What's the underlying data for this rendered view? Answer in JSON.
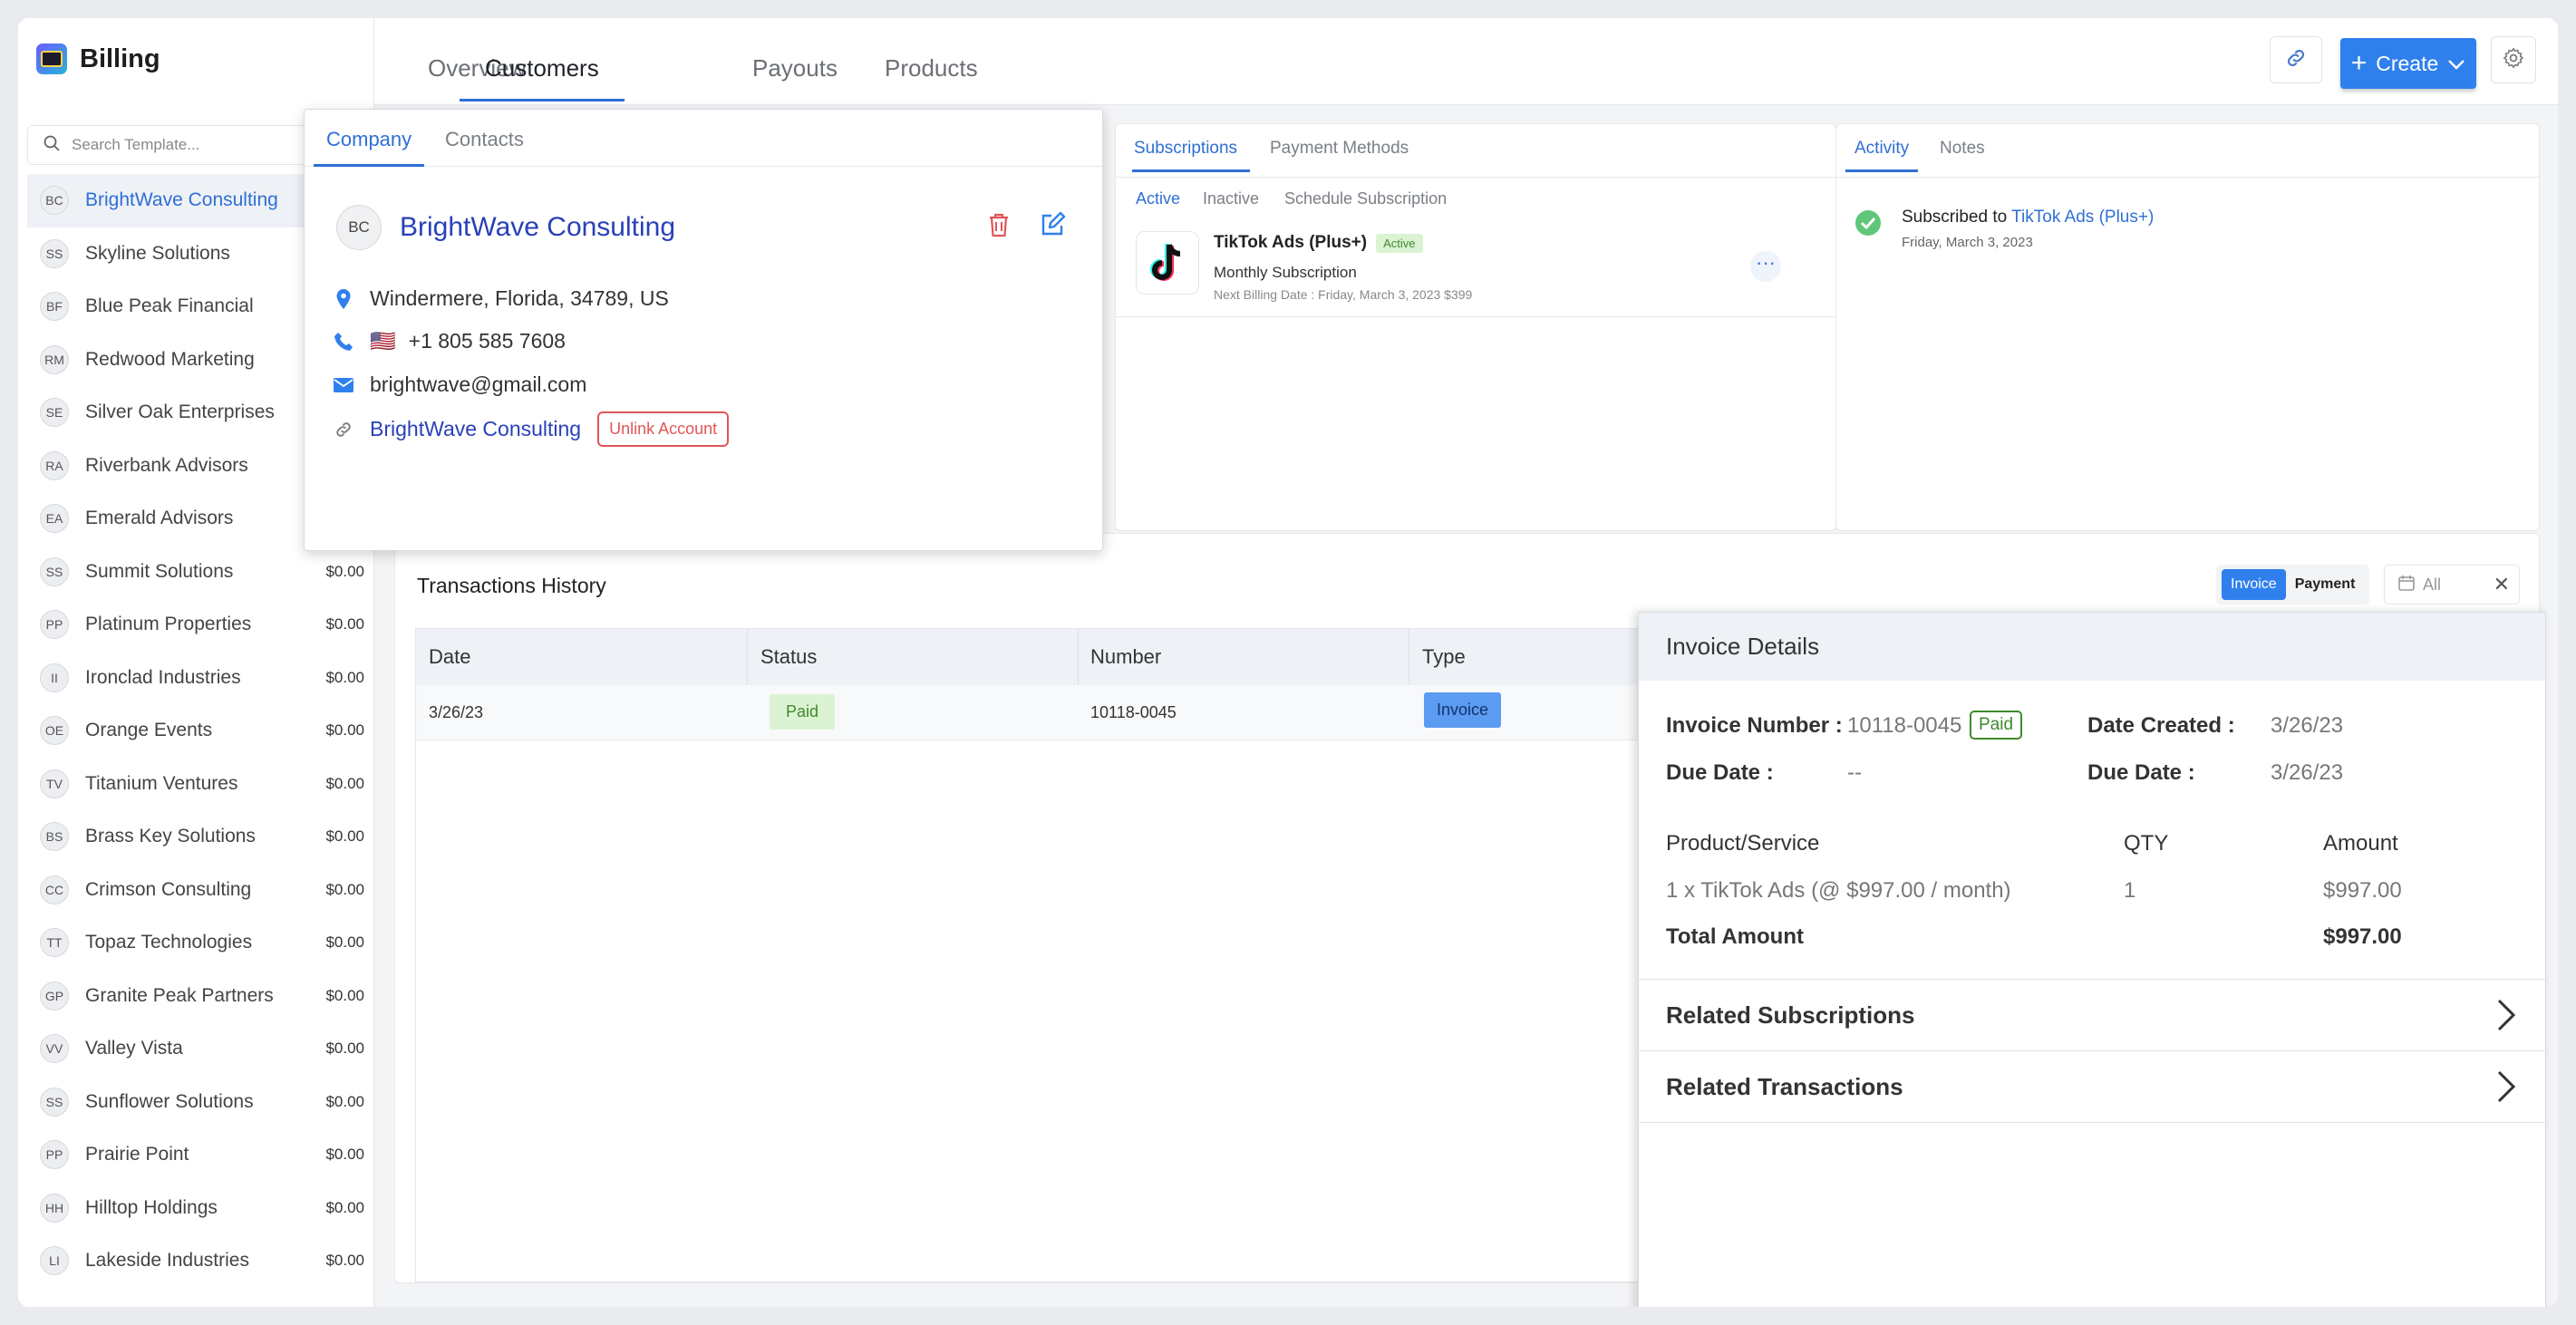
{
  "app": {
    "title": "Billing"
  },
  "nav": {
    "tabs": [
      "Overview",
      "Customers",
      "Payouts",
      "Products"
    ],
    "active": "Customers",
    "create_label": "Create"
  },
  "search": {
    "placeholder": "Search Template..."
  },
  "customers": [
    {
      "initials": "BC",
      "name": "BrightWave Consulting",
      "amount": ""
    },
    {
      "initials": "SS",
      "name": "Skyline Solutions",
      "amount": ""
    },
    {
      "initials": "BF",
      "name": "Blue Peak Financial",
      "amount": ""
    },
    {
      "initials": "RM",
      "name": "Redwood Marketing",
      "amount": ""
    },
    {
      "initials": "SE",
      "name": "Silver Oak Enterprises",
      "amount": ""
    },
    {
      "initials": "RA",
      "name": "Riverbank Advisors",
      "amount": ""
    },
    {
      "initials": "EA",
      "name": "Emerald Advisors",
      "amount": ""
    },
    {
      "initials": "SS",
      "name": "Summit Solutions",
      "amount": "$0.00"
    },
    {
      "initials": "PP",
      "name": "Platinum Properties",
      "amount": "$0.00"
    },
    {
      "initials": "II",
      "name": "Ironclad Industries",
      "amount": "$0.00"
    },
    {
      "initials": "OE",
      "name": "Orange Events",
      "amount": "$0.00"
    },
    {
      "initials": "TV",
      "name": "Titanium Ventures",
      "amount": "$0.00"
    },
    {
      "initials": "BS",
      "name": "Brass Key Solutions",
      "amount": "$0.00"
    },
    {
      "initials": "CC",
      "name": "Crimson Consulting",
      "amount": "$0.00"
    },
    {
      "initials": "TT",
      "name": "Topaz Technologies",
      "amount": "$0.00"
    },
    {
      "initials": "GP",
      "name": "Granite Peak Partners",
      "amount": "$0.00"
    },
    {
      "initials": "VV",
      "name": "Valley Vista",
      "amount": "$0.00"
    },
    {
      "initials": "SS",
      "name": "Sunflower Solutions",
      "amount": "$0.00"
    },
    {
      "initials": "PP",
      "name": "Prairie Point",
      "amount": "$0.00"
    },
    {
      "initials": "HH",
      "name": "Hilltop Holdings",
      "amount": "$0.00"
    },
    {
      "initials": "LI",
      "name": "Lakeside Industries",
      "amount": "$0.00"
    }
  ],
  "company": {
    "tabs": {
      "company": "Company",
      "contacts": "Contacts"
    },
    "initials": "BC",
    "name": "BrightWave Consulting",
    "address": "Windermere, Florida, 34789, US",
    "flag": "🇺🇸",
    "phone": "+1 805 585 7608",
    "email": "brightwave@gmail.com",
    "linked_account": "BrightWave Consulting",
    "unlink_label": "Unlink Account"
  },
  "subscriptions": {
    "tabs": {
      "subscriptions": "Subscriptions",
      "payment_methods": "Payment Methods"
    },
    "filters": {
      "active": "Active",
      "inactive": "Inactive",
      "schedule": "Schedule Subscription"
    },
    "item": {
      "name": "TikTok Ads (Plus+)",
      "status": "Active",
      "type": "Monthly Subscription",
      "next_billing": "Next Billing Date : Friday, March 3, 2023  $399",
      "more": "···"
    }
  },
  "activity": {
    "tabs": {
      "activity": "Activity",
      "notes": "Notes"
    },
    "item": {
      "prefix": "Subscribed to",
      "link": "TikTok Ads (Plus+)",
      "date": "Friday, March 3, 2023"
    }
  },
  "transactions": {
    "title": "Transactions History",
    "toggle": {
      "invoice": "Invoice",
      "payment": "Payment"
    },
    "filter": "All",
    "columns": {
      "date": "Date",
      "status": "Status",
      "number": "Number",
      "type": "Type"
    },
    "row": {
      "date": "3/26/23",
      "status": "Paid",
      "number": "10118-0045",
      "type": "Invoice"
    }
  },
  "invoice": {
    "title": "Invoice Details",
    "number_label": "Invoice Number :",
    "number": "10118-0045",
    "status": "Paid",
    "date_created_label": "Date Created :",
    "date_created": "3/26/23",
    "due_label_left": "Due Date :",
    "due_left": "--",
    "due_label_right": "Due Date :",
    "due_right": "3/26/23",
    "product_header": "Product/Service",
    "qty_header": "QTY",
    "amount_header": "Amount",
    "product": "1 x TikTok Ads (@ $997.00 / month)",
    "qty": "1",
    "amount": "$997.00",
    "total_label": "Total Amount",
    "total": "$997.00",
    "related_subscriptions": "Related Subscriptions",
    "related_transactions": "Related Transactions"
  },
  "colors": {
    "accent": "#2f80ed",
    "link": "#2f6fd6",
    "danger": "#e05656",
    "success": "#3f8a2d"
  }
}
